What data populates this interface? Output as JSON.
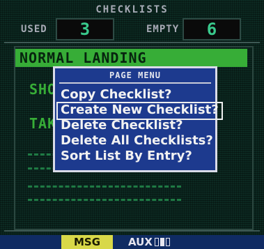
{
  "header": {
    "title": "CHECKLISTS"
  },
  "counts": {
    "used_label": "USED",
    "used_value": "3",
    "empty_label": "EMPTY",
    "empty_value": "6"
  },
  "checklists": {
    "items": [
      "NORMAL LANDING",
      "SHO",
      "TAK"
    ],
    "selected_index": 0
  },
  "page_menu": {
    "title": "PAGE MENU",
    "items": [
      "Copy Checklist?",
      "Create New Checklist?",
      "Delete Checklist?",
      "Delete All Checklists?",
      "Sort List By Entry?"
    ],
    "selected_index": 1
  },
  "status_bar": {
    "msg_label": "MSG",
    "aux_label": "AUX",
    "page_count": 3,
    "active_page": 1
  },
  "colors": {
    "screen_bg": "#0c2a22",
    "list_text": "#37ad37",
    "menu_bg": "#1d3a8e",
    "msg_bg": "#d8d848",
    "status_bg": "#0f2b63"
  }
}
